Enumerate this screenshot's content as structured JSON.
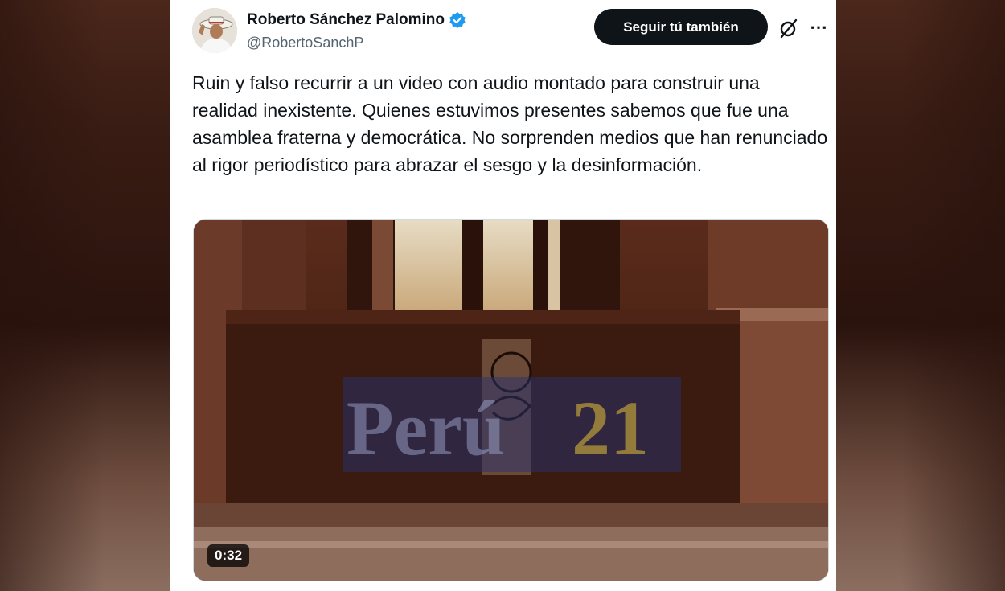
{
  "author": {
    "name": "Roberto Sánchez Palomino",
    "handle": "@RobertoSanchP",
    "verified": true
  },
  "actions": {
    "follow_label": "Seguir tú también",
    "grok_icon": "grok-icon",
    "more_icon": "more-icon"
  },
  "tweet": {
    "text": "Ruin y falso recurrir a un video con audio montado para construir una realidad inexistente. Quienes estuvimos presentes sabemos que fue una asamblea fraterna y democrática. No sorprenden medios que han renunciado al rigor periodístico para abrazar el sesgo y la desinformación."
  },
  "media": {
    "type": "video",
    "duration": "0:32",
    "watermark_text": "Perú21"
  },
  "colors": {
    "verified_blue": "#1d9bf0",
    "follow_button_bg": "#0f1419",
    "text_primary": "#0f1419",
    "text_secondary": "#536471"
  }
}
